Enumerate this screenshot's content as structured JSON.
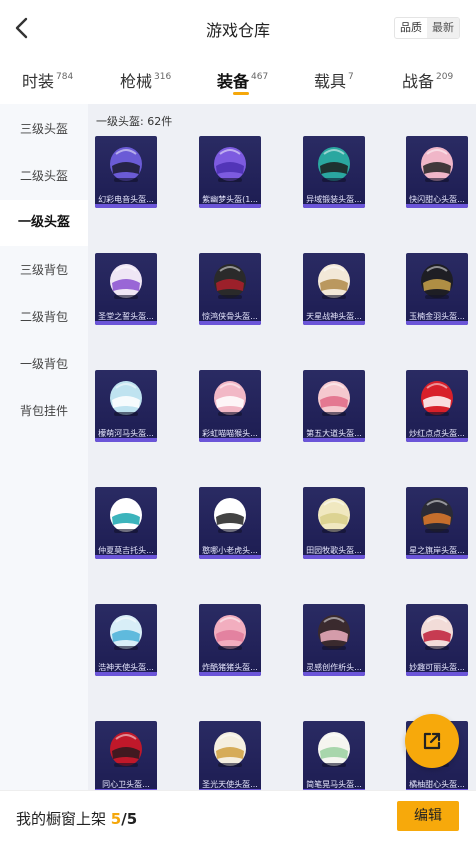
{
  "header": {
    "title": "游戏仓库",
    "sort_quality": "品质",
    "sort_latest": "最新"
  },
  "tabs": [
    {
      "label": "时装",
      "count": "784"
    },
    {
      "label": "枪械",
      "count": "316"
    },
    {
      "label": "装备",
      "count": "467"
    },
    {
      "label": "载具",
      "count": "7"
    },
    {
      "label": "战备",
      "count": "209"
    }
  ],
  "sidebar": {
    "items": [
      "三级头盔",
      "二级头盔",
      "一级头盔",
      "三级背包",
      "二级背包",
      "一级背包",
      "背包挂件"
    ],
    "active": "一级头盔"
  },
  "content": {
    "count_label": "一级头盔: 62件"
  },
  "items": [
    {
      "name": "幻彩电音头盔...",
      "color": "#6b5bd6",
      "accent": "#1a1a2e"
    },
    {
      "name": "紫幽梦头盔(1...",
      "color": "#7d5be0",
      "accent": "#4a2fb0"
    },
    {
      "name": "异域锻装头盔...",
      "color": "#2aa7a0",
      "accent": "#1c1c1c"
    },
    {
      "name": "快闪甜心头盔...",
      "color": "#f0b6c8",
      "accent": "#222222"
    },
    {
      "name": "圣堂之誓头盔...",
      "color": "#efe6f5",
      "accent": "#8a4fd0"
    },
    {
      "name": "惊鸿侠骨头盔...",
      "color": "#2a2a2a",
      "accent": "#b01e2a"
    },
    {
      "name": "天星战神头盔...",
      "color": "#f2e8d8",
      "accent": "#b08a4a"
    },
    {
      "name": "玉楠金羽头盔...",
      "color": "#1e1e24",
      "accent": "#c9a24a"
    },
    {
      "name": "檬萌河马头盔...",
      "color": "#bfe3f0",
      "accent": "#ffffff"
    },
    {
      "name": "彩虹喵喵猴头...",
      "color": "#f2b8c6",
      "accent": "#ffffff"
    },
    {
      "name": "第五大道头盔...",
      "color": "#f5c9cf",
      "accent": "#e06a86"
    },
    {
      "name": "炒红点点头盔...",
      "color": "#d8202a",
      "accent": "#ffffff"
    },
    {
      "name": "仲夏莫吉托头...",
      "color": "#ffffff",
      "accent": "#1aa7b0"
    },
    {
      "name": "憨哪小老虎头...",
      "color": "#ffffff",
      "accent": "#222222"
    },
    {
      "name": "田园牧歌头盔...",
      "color": "#f0e8c0",
      "accent": "#d8cf8a"
    },
    {
      "name": "星之旗岸头盔...",
      "color": "#2b2b36",
      "accent": "#e07a2a"
    },
    {
      "name": "浩神天使头盔...",
      "color": "#d8eef7",
      "accent": "#4ab0d8"
    },
    {
      "name": "炸酷猪猪头盔...",
      "color": "#f2aebf",
      "accent": "#e07a9a"
    },
    {
      "name": "灵感创作析头...",
      "color": "#3a2a2e",
      "accent": "#f0b0c0"
    },
    {
      "name": "妙趣可丽头盔...",
      "color": "#f2dcd8",
      "accent": "#c01e3a"
    },
    {
      "name": "同心卫头盔...",
      "color": "#c0182a",
      "accent": "#2a1a1e"
    },
    {
      "name": "圣光天使头盔...",
      "color": "#f5efe0",
      "accent": "#d0a040"
    },
    {
      "name": "简笔晃马头盔...",
      "color": "#f5f5f0",
      "accent": "#9ad0a0"
    },
    {
      "name": "橘柚甜心头盔...",
      "color": "#f5e8d0",
      "accent": "#f08a2a"
    }
  ],
  "footer": {
    "label": "我的橱窗上架",
    "current": "5",
    "total": "/5",
    "edit_label": "编辑"
  }
}
